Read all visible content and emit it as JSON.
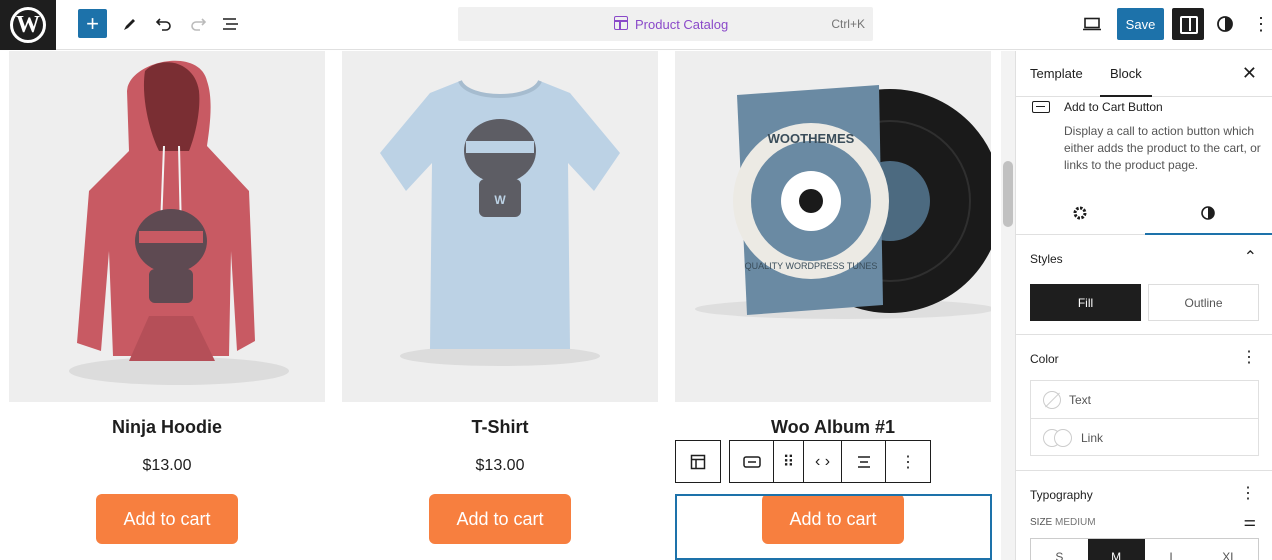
{
  "topbar": {
    "logo_letter": "W",
    "command": {
      "title": "Product Catalog",
      "shortcut": "Ctrl+K"
    },
    "save_label": "Save"
  },
  "products": [
    {
      "name": "Ninja Hoodie",
      "price": "$13.00",
      "cart_label": "Add to cart"
    },
    {
      "name": "T-Shirt",
      "price": "$13.00",
      "cart_label": "Add to cart"
    },
    {
      "name": "Woo Album #1",
      "price": "",
      "cart_label": "Add to cart"
    }
  ],
  "album_art": {
    "ring_top": "WOOTHEMES",
    "ring_bottom": "QUALITY WORDPRESS TUNES"
  },
  "inspector": {
    "tabs": [
      "Template",
      "Block"
    ],
    "active_tab": "Block",
    "block": {
      "title": "Add to Cart Button",
      "description": "Display a call to action button which either adds the product to the cart, or links to the product page."
    },
    "styles": {
      "heading": "Styles",
      "options": [
        "Fill",
        "Outline"
      ],
      "selected": "Fill"
    },
    "color": {
      "heading": "Color",
      "items": [
        "Text",
        "Link"
      ]
    },
    "typography": {
      "heading": "Typography",
      "size_label": "SIZE",
      "size_value": "MEDIUM",
      "sizes": [
        "S",
        "M",
        "L",
        "XL"
      ],
      "selected_size": "M"
    }
  },
  "colors": {
    "accent": "#1d72aa",
    "cart_button": "#f77f3f",
    "command_title": "#8a49c9",
    "dark": "#1e1e1e"
  }
}
